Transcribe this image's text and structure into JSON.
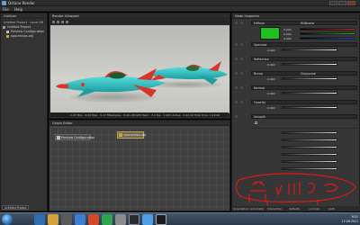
{
  "window": {
    "title": "Octane Render",
    "menu": [
      "File",
      "Help"
    ]
  },
  "outline": {
    "title": "Outliner",
    "subhead": "Untitled Project · Local DB",
    "tree": [
      {
        "label": "Untitled Project",
        "depth": 0
      },
      {
        "label": "Preview Configuration",
        "depth": 1
      },
      {
        "label": "spaceships.obj",
        "depth": 1
      }
    ],
    "bottom_tab": "Untitled Project"
  },
  "viewport": {
    "title": "Render Viewport",
    "status": "2.07 Mi/s · 2/16 Mpx · 5.17 MSamples · 8.9/1.08 GPU Mem · 3.1 fps · 1 GPU Active · 1:22:22 Total time: 1:22:02"
  },
  "graph": {
    "title": "Graph Editor",
    "nodes": [
      {
        "label": "Preview Configuration",
        "kind": "config"
      },
      {
        "label": "spaceships.obj",
        "kind": "mesh"
      }
    ]
  },
  "inspector": {
    "title": "Node Inspector",
    "rows": [
      {
        "label": "Diffuse",
        "value": "RGBcolor",
        "kind": "color",
        "color": "#1fc01f"
      },
      {
        "label": "Material",
        "value": "",
        "kind": "sliders",
        "slider_values": [
          "0.000",
          "0.000",
          "0.000"
        ]
      },
      {
        "label": "Specular",
        "value": "",
        "kind": "section"
      },
      {
        "label": "Roughness",
        "value": "0.000",
        "kind": "slider"
      },
      {
        "label": "Reflection",
        "value": "",
        "kind": "section"
      },
      {
        "label": "Roughness",
        "value": "0.000",
        "kind": "slider"
      },
      {
        "label": "Bump",
        "value": "Grayscale",
        "kind": "section"
      },
      {
        "label": "Roughness",
        "value": "0.000",
        "kind": "slider"
      },
      {
        "label": "Normal",
        "value": "",
        "kind": "section"
      },
      {
        "label": "Roughness",
        "value": "0.000",
        "kind": "slider"
      },
      {
        "label": "Opacity",
        "value": "",
        "kind": "section"
      },
      {
        "label": "Roughness",
        "value": "0.000",
        "kind": "slider"
      },
      {
        "label": "Smooth",
        "value": "",
        "kind": "check"
      }
    ],
    "status": [
      "Orientation: Automatic",
      "Interaction",
      "defaults",
      "normals",
      "path"
    ]
  },
  "taskbar": {
    "clock_time": "6:52",
    "clock_date": "12.06.2011"
  },
  "colors": {
    "ship_body": "#2fc2c4",
    "ship_accent": "#d9342c",
    "diffuse": "#1fc01f",
    "annotation": "#e01818"
  }
}
